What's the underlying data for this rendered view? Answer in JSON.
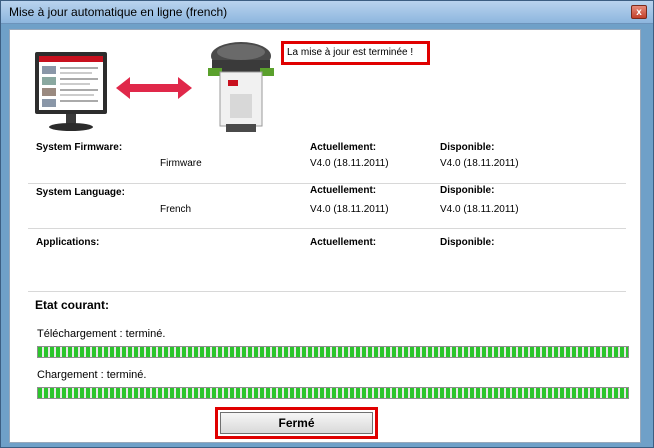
{
  "window": {
    "title": "Mise à jour automatique en ligne (french)",
    "close_glyph": "x"
  },
  "status_message": "La mise à jour est terminée !",
  "sections": {
    "firmware": {
      "label": "System Firmware:",
      "current_label": "Actuellement:",
      "available_label": "Disponible:",
      "item_name": "Firmware",
      "current_value": "V4.0 (18.11.2011)",
      "available_value": "V4.0 (18.11.2011)"
    },
    "language": {
      "label": "System Language:",
      "current_label": "Actuellement:",
      "available_label": "Disponible:",
      "item_name": "French",
      "current_value": "V4.0 (18.11.2011)",
      "available_value": "V4.0 (18.11.2011)"
    },
    "applications": {
      "label": "Applications:",
      "current_label": "Actuellement:",
      "available_label": "Disponible:"
    }
  },
  "etat": {
    "heading": "Etat courant:",
    "download": {
      "label": "Téléchargement : terminé.",
      "progress": 1.0
    },
    "upload": {
      "label": "Chargement : terminé.",
      "progress": 1.0
    }
  },
  "close_button": {
    "label": "Fermé"
  },
  "colors": {
    "highlight": "#e00000",
    "progress": "#2bc52b",
    "arrow": "#e0284a"
  },
  "icons": {
    "monitor": "computer-monitor-icon",
    "arrow": "double-arrow-icon",
    "rover": "gnss-receiver-icon"
  }
}
